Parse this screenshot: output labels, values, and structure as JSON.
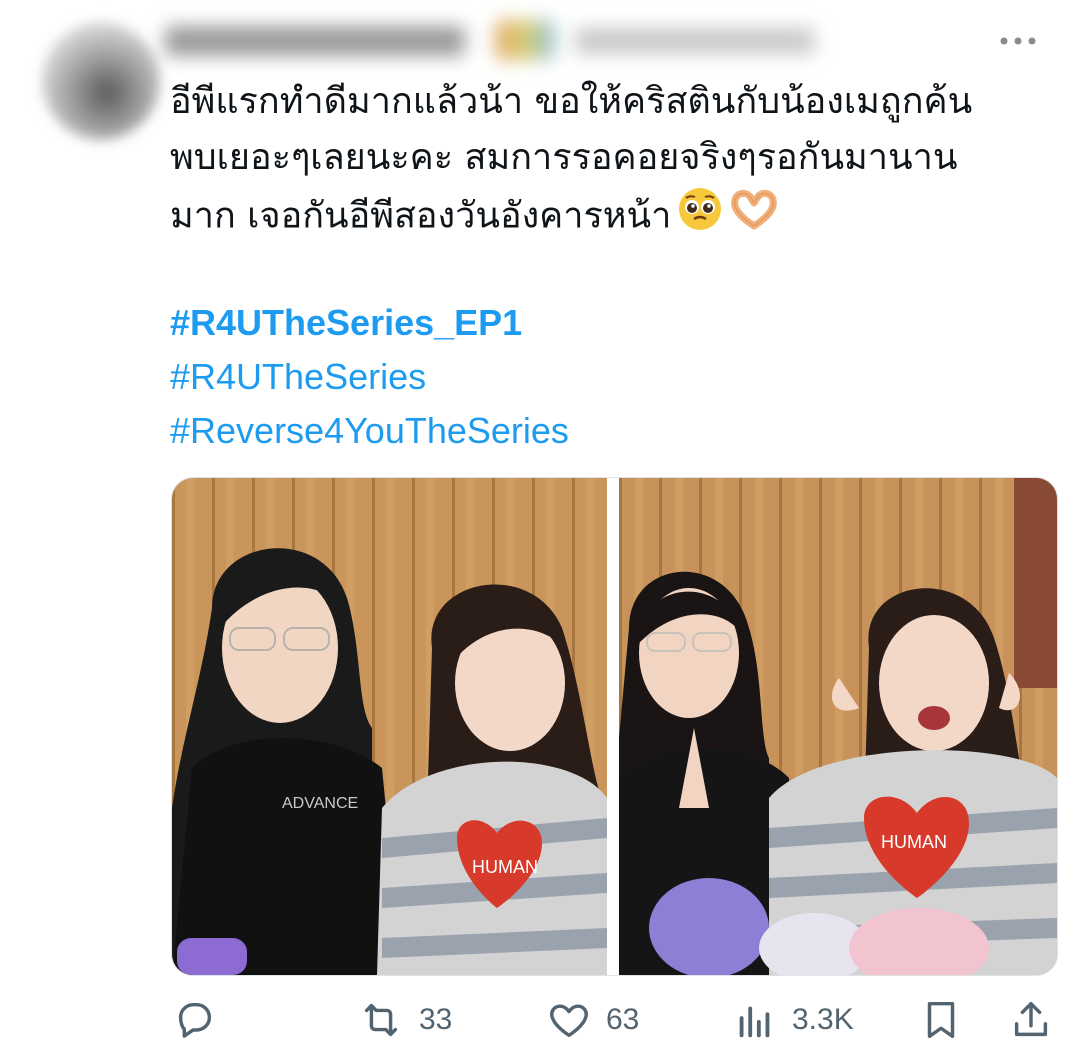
{
  "tweet": {
    "more_icon": "more-horizontal-icon",
    "text_lines": [
      "อีพีแรกทำดีมากแล้วน้า ขอให้คริสตินกับน้องเมถูกค้น",
      "พบเยอะๆเลยนะคะ สมการรอคอยจริงๆรอกันมานาน",
      "มาก เจอกันอีพีสองวันอังคารหน้า"
    ],
    "emojis": [
      "pleading-face-emoji",
      "heart-hands-emoji"
    ],
    "hashtags": [
      "#R4UTheSeries_EP1",
      "#R4UTheSeries",
      "#Reverse4YouTheSeries"
    ]
  },
  "actions": {
    "reply": {
      "icon": "reply-icon"
    },
    "retweet": {
      "icon": "retweet-icon",
      "count": "33"
    },
    "like": {
      "icon": "heart-icon",
      "count": "63"
    },
    "views": {
      "icon": "views-chart-icon",
      "count": "3.3K"
    },
    "bookmark": {
      "icon": "bookmark-icon"
    },
    "share": {
      "icon": "share-icon"
    }
  },
  "colors": {
    "hashtag": "#1d9bf0",
    "text": "#0f1419",
    "muted": "#536471"
  }
}
